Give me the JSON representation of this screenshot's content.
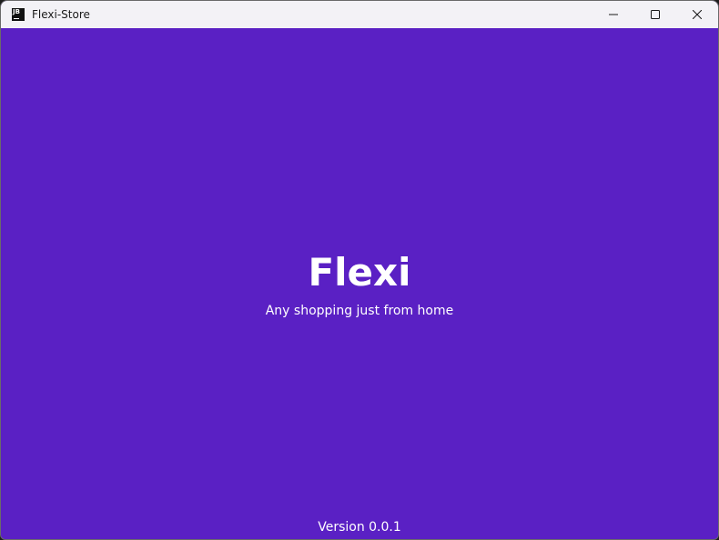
{
  "window": {
    "title": "Flexi-Store",
    "app_icon_text": "JB",
    "controls": {
      "minimize_icon": "minimize-icon",
      "maximize_icon": "maximize-icon",
      "close_icon": "close-icon"
    }
  },
  "splash": {
    "brand": "Flexi",
    "tagline": "Any shopping just from home",
    "version": "Version 0.0.1"
  },
  "colors": {
    "background": "#5a20c4",
    "titlebar": "#f3f2f6",
    "text": "#ffffff"
  }
}
